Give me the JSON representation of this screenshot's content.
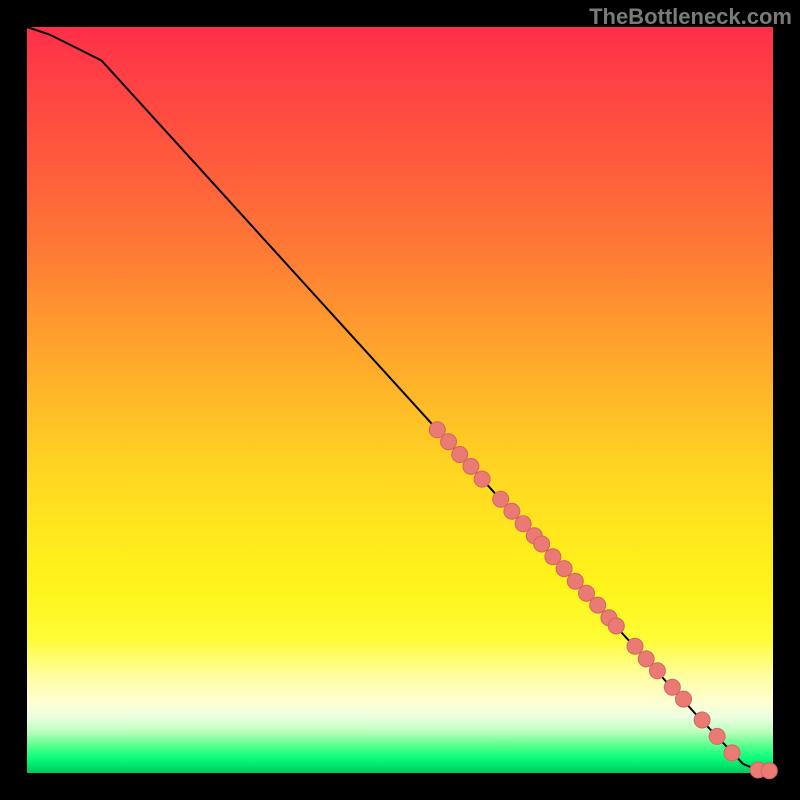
{
  "watermark": "TheBottleneck.com",
  "chart_data": {
    "type": "line",
    "title": "",
    "xlabel": "",
    "ylabel": "",
    "xlim": [
      0,
      100
    ],
    "ylim": [
      0,
      100
    ],
    "grid": false,
    "legend": false,
    "series": [
      {
        "name": "curve",
        "x": [
          0,
          3,
          6,
          10,
          20,
          30,
          40,
          50,
          60,
          70,
          80,
          90,
          96,
          98,
          100
        ],
        "y": [
          100,
          99,
          97.5,
          95.5,
          84.5,
          73.5,
          62.5,
          51.5,
          40.5,
          29.5,
          18.5,
          7.5,
          1.2,
          0.4,
          0.3
        ]
      }
    ],
    "points": {
      "name": "highlighted-segment",
      "x": [
        55,
        56.5,
        58,
        59.5,
        61,
        63.5,
        65,
        66.5,
        68,
        69,
        70.5,
        72,
        73.5,
        75,
        76.5,
        78,
        79,
        81.5,
        83,
        84.5,
        86.5,
        88,
        90.5,
        92.5,
        94.5,
        98,
        99.5
      ],
      "y": [
        46,
        44.4,
        42.7,
        41.1,
        39.4,
        36.7,
        35.1,
        33.4,
        31.8,
        30.7,
        29.0,
        27.4,
        25.7,
        24.1,
        22.5,
        20.8,
        19.7,
        17.0,
        15.3,
        13.7,
        11.5,
        9.9,
        7.1,
        4.9,
        2.7,
        0.4,
        0.3
      ]
    },
    "colors": {
      "curve": "#000000",
      "points": "#ea7a74",
      "gradient_top": "#ff2e49",
      "gradient_bottom": "#00c85e"
    }
  }
}
